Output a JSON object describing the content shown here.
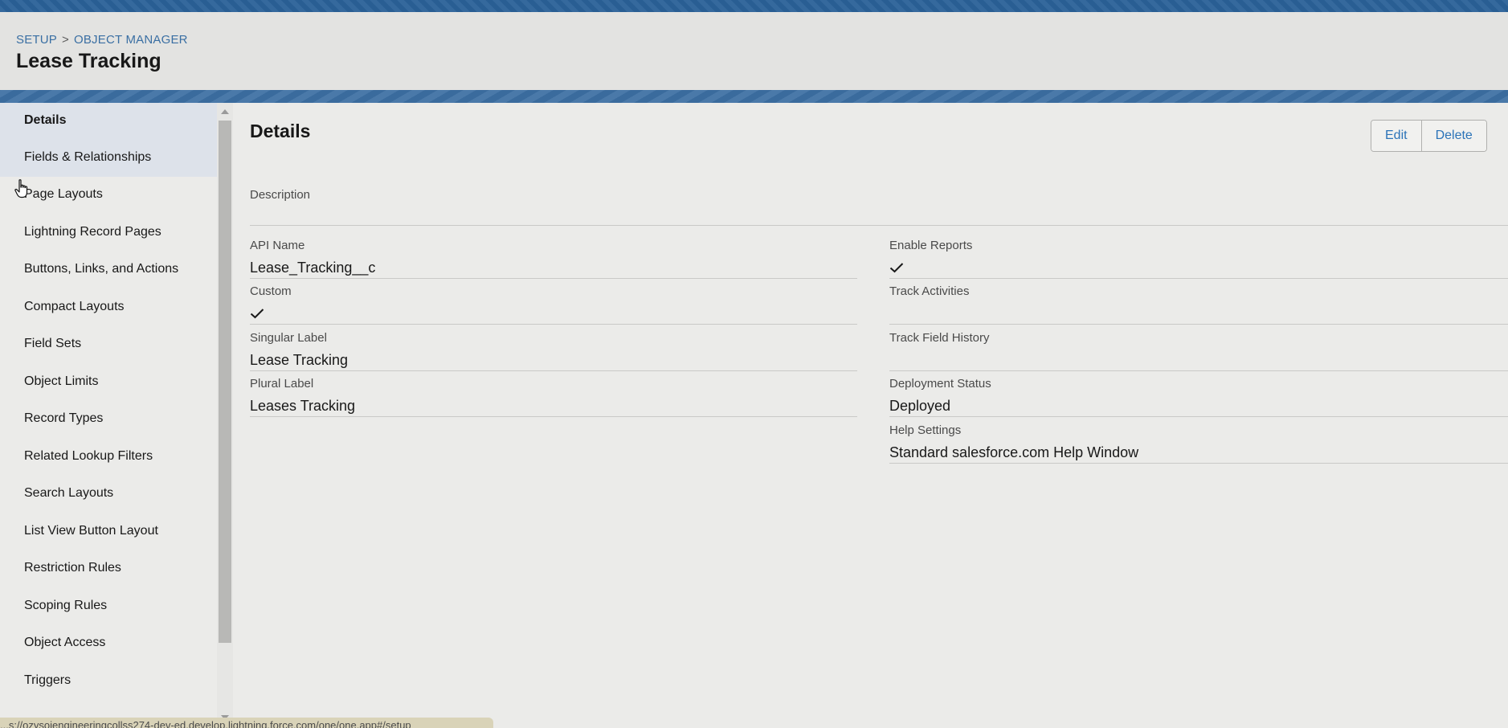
{
  "header": {
    "breadcrumb": [
      "SETUP",
      "OBJECT MANAGER"
    ],
    "breadcrumb_separator": ">",
    "title": "Lease Tracking"
  },
  "sidebar": {
    "items": [
      {
        "label": "Details",
        "active": true
      },
      {
        "label": "Fields & Relationships",
        "hover": true
      },
      {
        "label": "Page Layouts"
      },
      {
        "label": "Lightning Record Pages"
      },
      {
        "label": "Buttons, Links, and Actions"
      },
      {
        "label": "Compact Layouts"
      },
      {
        "label": "Field Sets"
      },
      {
        "label": "Object Limits"
      },
      {
        "label": "Record Types"
      },
      {
        "label": "Related Lookup Filters"
      },
      {
        "label": "Search Layouts"
      },
      {
        "label": "List View Button Layout"
      },
      {
        "label": "Restriction Rules"
      },
      {
        "label": "Scoping Rules"
      },
      {
        "label": "Object Access"
      },
      {
        "label": "Triggers"
      }
    ]
  },
  "main": {
    "title": "Details",
    "buttons": {
      "edit": "Edit",
      "delete": "Delete"
    },
    "description": {
      "label": "Description",
      "value": ""
    },
    "left_fields": [
      {
        "label": "API Name",
        "value": "Lease_Tracking__c"
      },
      {
        "label": "Custom",
        "value": "",
        "checked": true
      },
      {
        "label": "Singular Label",
        "value": "Lease Tracking"
      },
      {
        "label": "Plural Label",
        "value": "Leases Tracking"
      }
    ],
    "right_fields": [
      {
        "label": "Enable Reports",
        "value": "",
        "checked": true
      },
      {
        "label": "Track Activities",
        "value": ""
      },
      {
        "label": "Track Field History",
        "value": ""
      },
      {
        "label": "Deployment Status",
        "value": "Deployed"
      },
      {
        "label": "Help Settings",
        "value": "Standard salesforce.com Help Window"
      }
    ]
  },
  "status_bar": {
    "url": "...s://ozysoiengineeringcollss274-dev-ed.develop.lightning.force.com/one/one.app#/setup"
  },
  "colors": {
    "brand_band": "#2a6198",
    "link": "#2b73b8",
    "active_nav": "#dde2ea"
  },
  "icons": [
    "check-icon",
    "hand-pointer-icon",
    "scroll-up-icon",
    "scroll-down-icon"
  ]
}
